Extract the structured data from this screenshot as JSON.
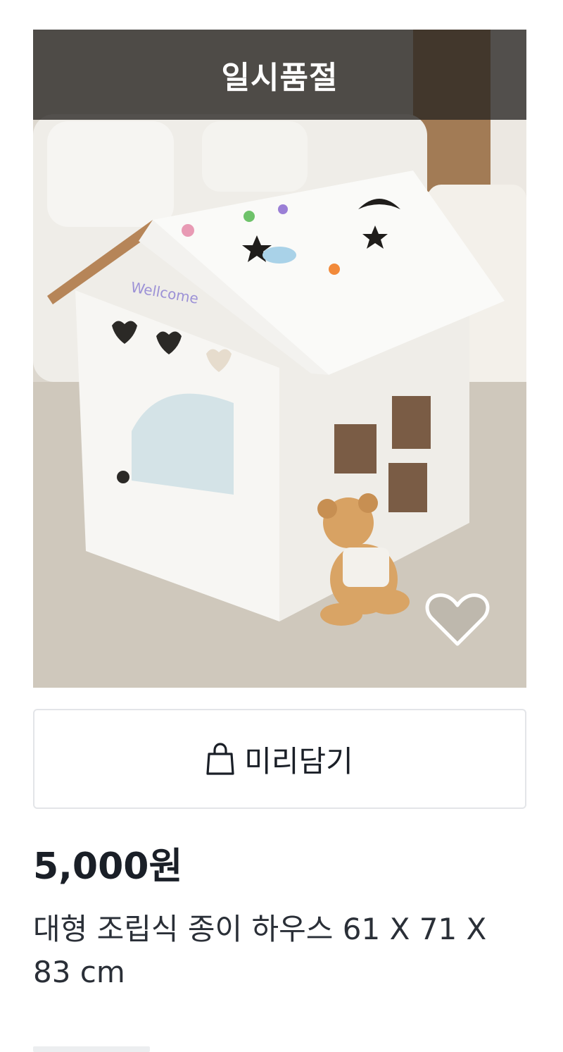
{
  "product": {
    "image_alt": "대형 조립식 종이 하우스",
    "soldout_label": "일시품절",
    "wish_icon": "heart-outline-icon",
    "cart_icon": "shopping-bag-icon",
    "cart_label": "미리담기",
    "price": "5,000원",
    "title": "대형 조립식 종이 하우스 61 X 71 X 83 cm",
    "wall_text": "Wellcome"
  },
  "colors": {
    "text": "#1a1f27",
    "overlay": "#262421",
    "border": "#e3e5e8"
  }
}
